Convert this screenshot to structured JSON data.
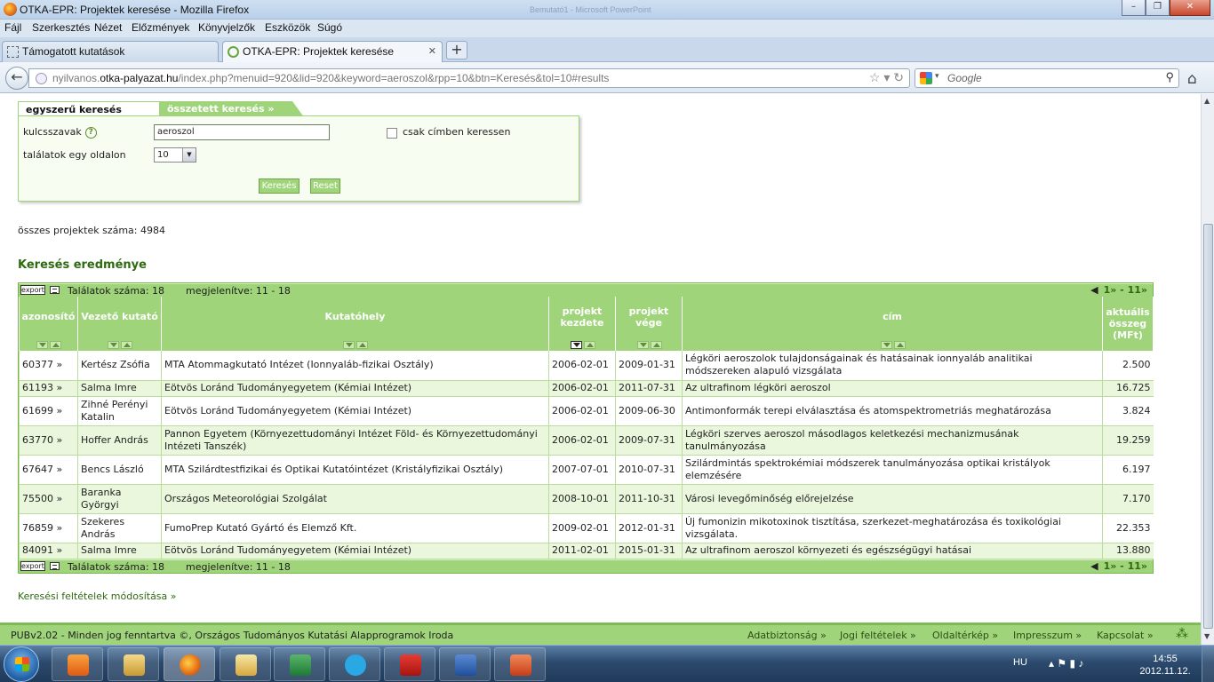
{
  "window": {
    "title": "OTKA-EPR: Projektek keresése - Mozilla Firefox",
    "ghost_title": "Bemutató1 - Microsoft PowerPoint"
  },
  "menu": [
    "Fájl",
    "Szerkesztés",
    "Nézet",
    "Előzmények",
    "Könyvjelzők",
    "Eszközök",
    "Súgó"
  ],
  "tabs": [
    {
      "label": "Támogatott kutatások"
    },
    {
      "label": "OTKA-EPR: Projektek keresése"
    }
  ],
  "url": {
    "prefix": "nyilvanos.",
    "host": "otka-palyazat.hu",
    "path": "/index.php?menuid=920&lid=920&keyword=aeroszol&rpp=10&btn=Keresés&tol=10#results"
  },
  "search_engine": {
    "placeholder": "Google"
  },
  "search_tabs": {
    "simple": "egyszerű keresés",
    "advanced": "összetett keresés »"
  },
  "form": {
    "keyword_label": "kulcsszavak",
    "keyword_value": "aeroszol",
    "title_only_label": "csak címben keressen",
    "rpp_label": "találatok egy oldalon",
    "rpp_value": "10",
    "search_btn": "Keresés",
    "reset_btn": "Reset"
  },
  "total_projects": "összes projektek száma: 4984",
  "results_title": "Keresés eredménye",
  "bar": {
    "export": "export",
    "hits": "Találatok száma: 18",
    "shown": "megjelenítve: 11 - 18",
    "page_prev": "◀",
    "page": "1» - 11»"
  },
  "columns": [
    "azonosító",
    "Vezető kutató",
    "Kutatóhely",
    "projekt kezdete",
    "projekt vége",
    "cím",
    "aktuális összeg (MFt)"
  ],
  "rows": [
    {
      "id": "60377 »",
      "lead": "Kertész Zsófia",
      "inst": "MTA Atommagkutató Intézet (Ionnyaláb-fizikai Osztály)",
      "start": "2006-02-01",
      "end": "2009-01-31",
      "title": "Légköri aeroszolok tulajdonságainak és hatásainak ionnyaláb analitikai módszereken alapuló vizsgálata",
      "amount": "2.500"
    },
    {
      "id": "61193 »",
      "lead": "Salma Imre",
      "inst": "Eötvös Loránd Tudományegyetem (Kémiai Intézet)",
      "start": "2006-02-01",
      "end": "2011-07-31",
      "title": "Az ultrafinom légköri aeroszol",
      "amount": "16.725"
    },
    {
      "id": "61699 »",
      "lead": "Zihné Perényi Katalin",
      "inst": "Eötvös Loránd Tudományegyetem (Kémiai Intézet)",
      "start": "2006-02-01",
      "end": "2009-06-30",
      "title": "Antimonformák terepi elválasztása és atomspektrometriás meghatározása",
      "amount": "3.824"
    },
    {
      "id": "63770 »",
      "lead": "Hoffer András",
      "inst": "Pannon Egyetem (Környezettudományi Intézet Föld- és Környezettudományi Intézeti Tanszék)",
      "start": "2006-02-01",
      "end": "2009-07-31",
      "title": "Légköri szerves aeroszol másodlagos keletkezési mechanizmusának tanulmányozása",
      "amount": "19.259"
    },
    {
      "id": "67647 »",
      "lead": "Bencs László",
      "inst": "MTA Szilárdtestfizikai és Optikai Kutatóintézet (Kristályfizikai Osztály)",
      "start": "2007-07-01",
      "end": "2010-07-31",
      "title": "Szilárdmintás spektrokémiai módszerek tanulmányozása optikai kristályok elemzésére",
      "amount": "6.197"
    },
    {
      "id": "75500 »",
      "lead": "Baranka Györgyi",
      "inst": "Országos Meteorológiai Szolgálat",
      "start": "2008-10-01",
      "end": "2011-10-31",
      "title": "Városi levegőminőség előrejelzése",
      "amount": "7.170"
    },
    {
      "id": "76859 »",
      "lead": "Szekeres András",
      "inst": "FumoPrep Kutató Gyártó és Elemző Kft.",
      "start": "2009-02-01",
      "end": "2012-01-31",
      "title": "Új fumonizin mikotoxinok tisztítása, szerkezet-meghatározása és toxikológiai vizsgálata.",
      "amount": "22.353"
    },
    {
      "id": "84091 »",
      "lead": "Salma Imre",
      "inst": "Eötvös Loránd Tudományegyetem (Kémiai Intézet)",
      "start": "2011-02-01",
      "end": "2015-01-31",
      "title": "Az ultrafinom aeroszol környezeti és egészségügyi hatásai",
      "amount": "13.880"
    }
  ],
  "modify_link": "Keresési feltételek módosítása »",
  "footer": {
    "copyright": "PUBv2.02 - Minden jog fenntartva ©, Országos Tudományos Kutatási Alapprogramok Iroda",
    "links": [
      "Adatbiztonság »",
      "Jogi feltételek »",
      "Oldaltérkép »",
      "Impresszum »",
      "Kapcsolat »"
    ]
  },
  "taskbar": {
    "lang": "HU",
    "time": "14:55",
    "date": "2012.11.12."
  },
  "colors": {
    "accent": "#9fd47a",
    "row_alt": "#eaf7dd",
    "title_green": "#2e6b10"
  }
}
